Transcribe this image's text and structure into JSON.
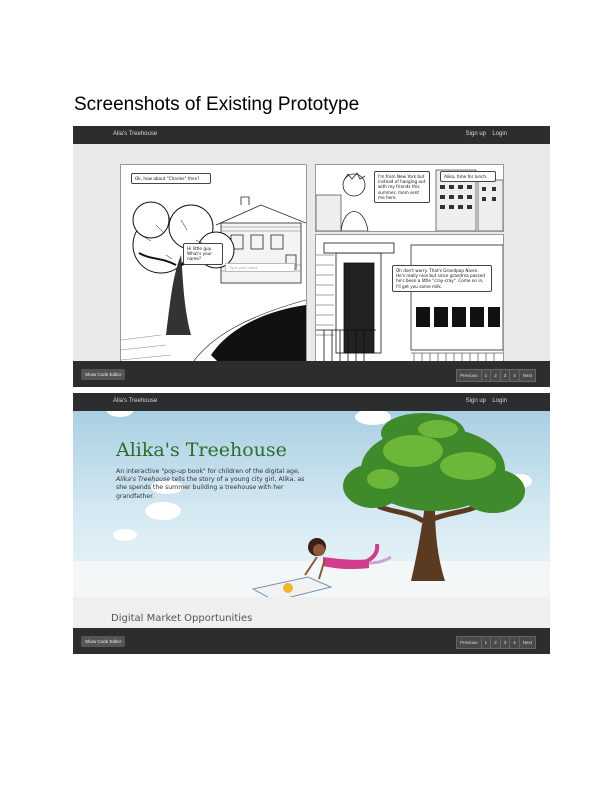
{
  "document": {
    "title": "Screenshots of Existing Prototype"
  },
  "navbar": {
    "brand": "Alia's Treehouse",
    "signup": "Sign up",
    "login": "Login"
  },
  "footer": {
    "code_button": "Show Code Editor",
    "pager": [
      "Previous",
      "1",
      "2",
      "3",
      "4",
      "Next"
    ]
  },
  "comic": {
    "bubble_1": "Ok, how about \"Charles\" then?",
    "bubble_2": "Hi little guy. What's your name?",
    "name_placeholder": "Type your name",
    "bubble_3": "I'm from New York but instead of hanging out with my friends this summer, mom sent me here.",
    "bubble_4": "Alika, time for lunch.",
    "bubble_5": "Oh don't worry. That's Grandpop Niven. He's really nice but since grandma passed he's been a little \"cray-cray\". Come on in, I'll get you some milk."
  },
  "landing": {
    "navbar": {
      "brand": "Alia's Treehouse",
      "signup": "Sign up",
      "login": "Login"
    },
    "title": "Alika's Treehouse",
    "intro_1": "An interactive \"pop-up book\" for children of the digital age,",
    "intro_italic": "Alika's Treehouse",
    "intro_2": " tells the story of a young city girl, Alika, as she spends the summer building a treehouse with her grandfather.",
    "section_title": "Digital Market Opportunities",
    "footer": {
      "code_button": "Show Code Editor",
      "pager": [
        "Previous",
        "1",
        "2",
        "3",
        "4",
        "Next"
      ]
    }
  },
  "colors": {
    "navbar": "#2c2d2e",
    "title_green": "#2e6c2a",
    "sky": "#a9cfe3"
  }
}
